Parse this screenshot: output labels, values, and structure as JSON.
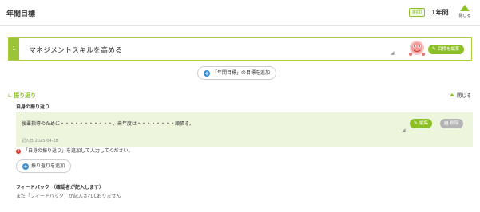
{
  "header": {
    "title": "年間目標",
    "period_badge": "期間",
    "period_value": "1年間",
    "collapse_label": "閉じる"
  },
  "goal": {
    "number": "1",
    "text": "マネジメントスキルを高める",
    "edit_button": "目標を編集"
  },
  "add_goal_button": "「年間目標」の目標を追加",
  "reflection": {
    "section_title": "振り返り",
    "close_label": "閉じる",
    "self_label": "自身の振り返り",
    "text": "後輩指導のために・・・・・・・・・・・。来年度は・・・・・・・・頑張る。",
    "date": "記入日:2025-04-28",
    "edit_button": "編集",
    "delete_button": "削除"
  },
  "warning": "「自身の振り返り」を追加して入力してください。",
  "add_reflection_button": "振り返りを追加",
  "feedback": {
    "label": "フィードバック （確認者が記入します）",
    "text": "まだ「フィードバック」が記入されておりません"
  },
  "colors": {
    "accent": "#8cbf26",
    "warning": "#d9372f",
    "info": "#3a8ed4"
  }
}
